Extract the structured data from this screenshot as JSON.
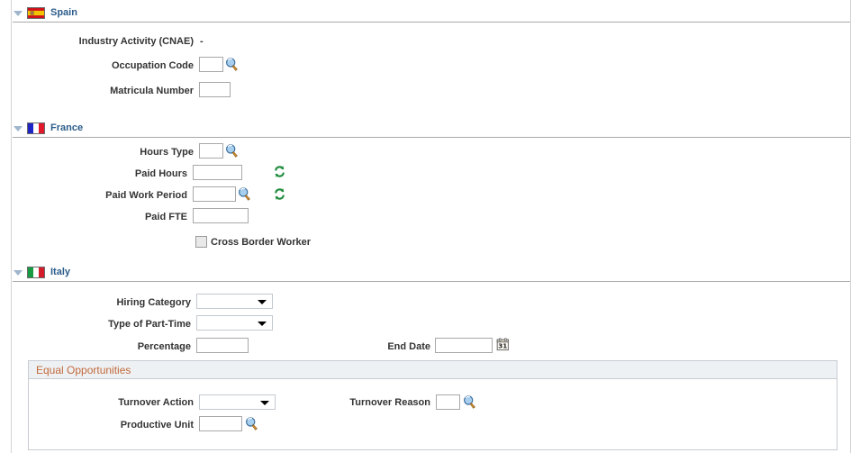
{
  "sections": [
    {
      "id": "spain",
      "title": "Spain",
      "flag": "flag-spain",
      "twisty": "twisty-expanded-icon",
      "fields": {
        "industry_activity_label": "Industry Activity (CNAE)",
        "industry_activity_value": "-",
        "occupation_code_label": "Occupation Code",
        "occupation_code_value": "",
        "matricula_number_label": "Matricula Number",
        "matricula_number_value": ""
      }
    },
    {
      "id": "france",
      "title": "France",
      "flag": "flag-france",
      "twisty": "twisty-expanded-icon",
      "fields": {
        "hours_type_label": "Hours Type",
        "hours_type_value": "",
        "paid_hours_label": "Paid Hours",
        "paid_hours_value": "",
        "paid_work_period_label": "Paid Work Period",
        "paid_work_period_value": "",
        "paid_fte_label": "Paid FTE",
        "paid_fte_value": "",
        "cross_border_worker_label": "Cross Border Worker",
        "cross_border_worker_checked": false
      }
    },
    {
      "id": "italy",
      "title": "Italy",
      "flag": "flag-italy",
      "twisty": "twisty-expanded-icon",
      "fields": {
        "hiring_category_label": "Hiring Category",
        "hiring_category_value": "",
        "type_of_part_time_label": "Type of Part-Time",
        "type_of_part_time_value": "",
        "percentage_label": "Percentage",
        "percentage_value": "",
        "end_date_label": "End Date",
        "end_date_value": ""
      },
      "subgroup": {
        "title": "Equal Opportunities",
        "fields": {
          "turnover_action_label": "Turnover Action",
          "turnover_action_value": "",
          "turnover_reason_label": "Turnover Reason",
          "turnover_reason_value": "",
          "productive_unit_label": "Productive Unit",
          "productive_unit_value": ""
        }
      }
    }
  ],
  "icons": {
    "lookup": "magnifying-glass-lookup-icon",
    "refresh": "refresh-arrows-icon",
    "calendar": "calendar-picker-icon"
  },
  "colors": {
    "group_title": "#2b5c8a",
    "subgroup_title": "#c2693a",
    "rule": "#a9a9a9",
    "field_border": "#a8a8a8",
    "subgroup_header_bg": "#eef1f4"
  }
}
